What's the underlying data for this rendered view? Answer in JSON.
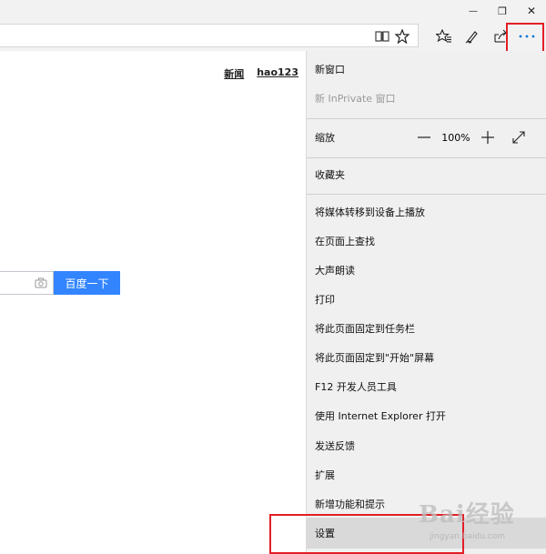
{
  "window": {
    "minimize_glyph": "—",
    "maximize_glyph": "❐",
    "close_glyph": "✕"
  },
  "toolbar": {
    "icons": [
      "reading-view-icon",
      "favorite-star-icon",
      "hub-icon",
      "web-note-icon",
      "share-icon",
      "more-icon"
    ]
  },
  "page": {
    "links": [
      "新闻",
      "hao123"
    ],
    "search_button": "百度一下"
  },
  "menu": {
    "new_window": "新窗口",
    "new_inprivate": "新 InPrivate 窗口",
    "zoom_label": "缩放",
    "zoom_value": "100%",
    "favorites": "收藏夹",
    "cast_media": "将媒体转移到设备上播放",
    "find_on_page": "在页面上查找",
    "read_aloud": "大声朗读",
    "print": "打印",
    "pin_taskbar": "将此页面固定到任务栏",
    "pin_start": "将此页面固定到\"开始\"屏幕",
    "devtools": "F12 开发人员工具",
    "open_ie": "使用 Internet Explorer 打开",
    "feedback": "发送反馈",
    "extensions": "扩展",
    "whats_new": "新增功能和提示",
    "settings": "设置"
  },
  "watermark": {
    "logo": "Bai经验",
    "sub": "jingyan.baidu.com"
  },
  "colors": {
    "accent_red": "#e21f26",
    "search_blue": "#3385ff",
    "more_icon_blue": "#0078d7"
  }
}
